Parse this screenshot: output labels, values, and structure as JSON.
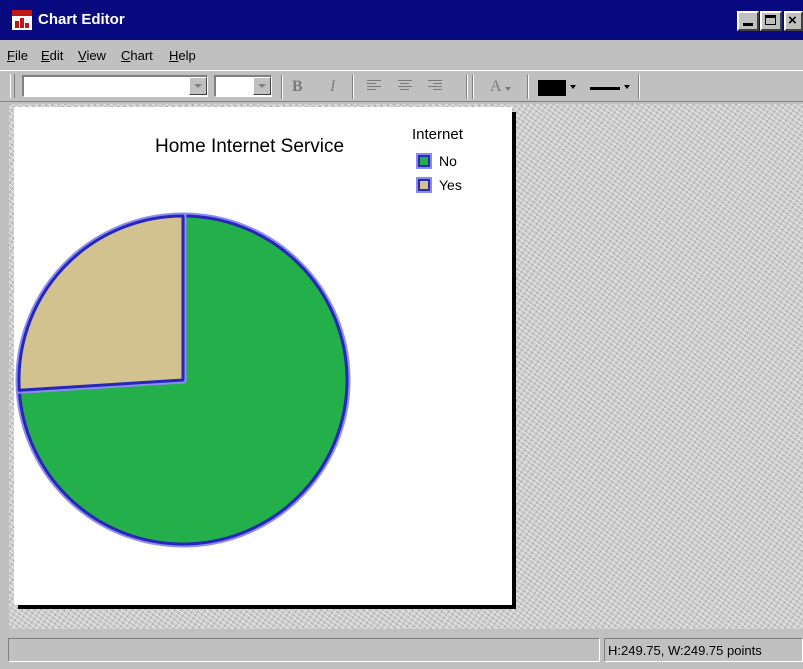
{
  "window": {
    "title": "Chart Editor"
  },
  "menu": {
    "items": [
      {
        "label": "File",
        "mnemonic": "F",
        "rest": "ile"
      },
      {
        "label": "Edit",
        "mnemonic": "E",
        "rest": "dit"
      },
      {
        "label": "View",
        "mnemonic": "V",
        "rest": "iew"
      },
      {
        "label": "Chart",
        "mnemonic": "C",
        "rest": "hart"
      },
      {
        "label": "Help",
        "mnemonic": "H",
        "rest": "elp"
      }
    ]
  },
  "toolbar": {
    "font_value": "",
    "size_value": "",
    "bold_label": "B",
    "italic_label": "I",
    "text_color_label": "A",
    "fill_color": "#000000",
    "icons": [
      "align-left-icon",
      "align-center-icon",
      "align-right-icon",
      "text-color-icon",
      "fill-color-icon",
      "line-style-icon"
    ]
  },
  "chart": {
    "title": "Home Internet Service",
    "legend": {
      "title": "Internet",
      "items": [
        {
          "label": "No",
          "color": "#23b04a"
        },
        {
          "label": "Yes",
          "color": "#d2c28f"
        }
      ]
    }
  },
  "chart_data": {
    "type": "pie",
    "title": "Home Internet Service",
    "legend_title": "Internet",
    "legend_position": "top-right",
    "slices": [
      {
        "label": "No",
        "value": 74,
        "color": "#23b04a"
      },
      {
        "label": "Yes",
        "value": 26,
        "color": "#d2c28f"
      }
    ],
    "outline_color": "#2626b8",
    "outline_halo": "#8c8cf2"
  },
  "status": {
    "left": "",
    "right": "H:249.75, W:249.75 points"
  }
}
